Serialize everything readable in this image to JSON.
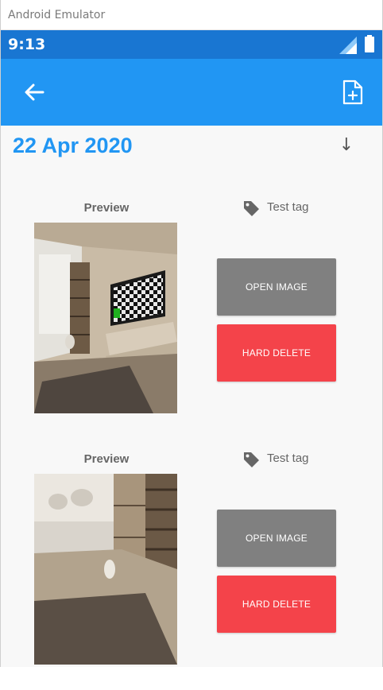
{
  "window": {
    "title": "Android Emulator"
  },
  "status_bar": {
    "time": "9:13",
    "color": "#1976d2"
  },
  "app_bar": {
    "color": "#2196f3",
    "back_icon": "arrow-left-icon",
    "action_icon": "file-plus-icon"
  },
  "header": {
    "date": "22 Apr 2020",
    "sort_icon": "arrow-down-icon"
  },
  "entries": [
    {
      "preview_label": "Preview",
      "tag_label": "Test tag",
      "open_button": "OPEN IMAGE",
      "delete_button": "HARD DELETE",
      "image": "room-with-tv-checkerboard"
    },
    {
      "preview_label": "Preview",
      "tag_label": "Test tag",
      "open_button": "OPEN IMAGE",
      "delete_button": "HARD DELETE",
      "image": "room-window-shelf"
    }
  ],
  "colors": {
    "accent": "#2196f3",
    "open_button": "#808080",
    "delete_button": "#f4434a",
    "background": "#f8f8f8"
  }
}
